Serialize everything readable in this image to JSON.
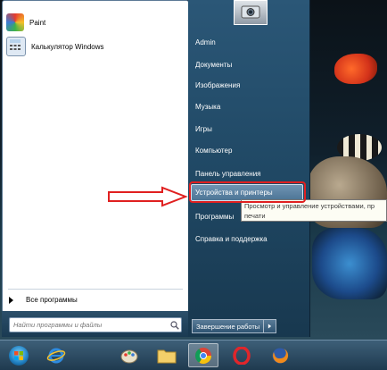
{
  "colors": {
    "accent_red": "#e02020",
    "panel_blue": "#1f4763",
    "tooltip_bg": "#fdfdf4"
  },
  "left_pane": {
    "programs": [
      {
        "label": "Paint",
        "icon": "paint-icon"
      },
      {
        "label": "Калькулятор Windows",
        "icon": "calculator-icon"
      }
    ],
    "all_programs": "Все программы",
    "search_placeholder": "Найти программы и файлы"
  },
  "right_pane": {
    "items": [
      {
        "label": "Admin"
      },
      {
        "label": "Документы"
      },
      {
        "label": "Изображения"
      },
      {
        "label": "Музыка"
      },
      {
        "label": "Игры"
      },
      {
        "label": "Компьютер"
      },
      {
        "label": "Панель управления"
      },
      {
        "label": "Устройства и принтеры"
      },
      {
        "label": "Программы"
      },
      {
        "label": "Справка и поддержка"
      }
    ],
    "shutdown": "Завершение работы"
  },
  "tooltip": {
    "line1": "Просмотр и управление устройствами, пр",
    "line2": "печати"
  },
  "taskbar": {
    "items": [
      "start-orb",
      "internet-explorer-icon",
      "paint-icon",
      "file-explorer-icon",
      "chrome-icon",
      "opera-icon",
      "firefox-icon"
    ]
  }
}
